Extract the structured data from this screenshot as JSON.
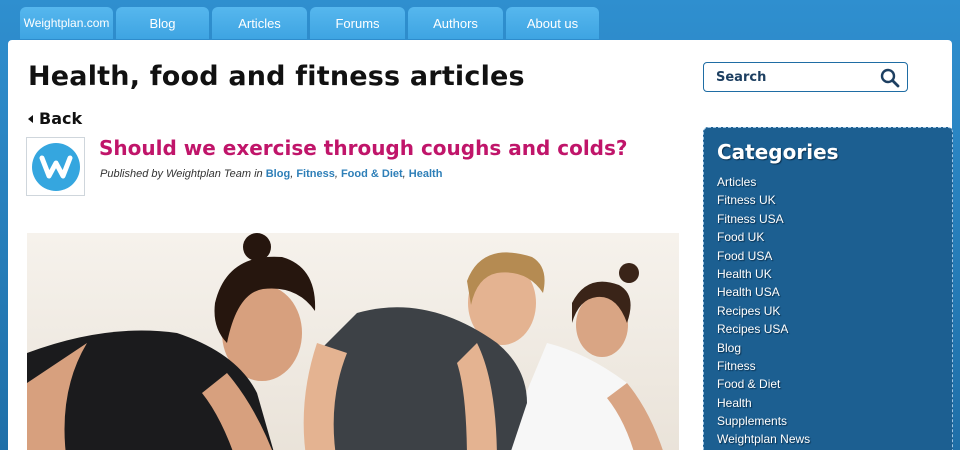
{
  "nav": {
    "brand": "Weightplan.com",
    "tabs": [
      "Blog",
      "Articles",
      "Forums",
      "Authors",
      "About us"
    ]
  },
  "page": {
    "title": "Health, food and fitness articles",
    "back_label": "Back"
  },
  "article": {
    "title": "Should we exercise through coughs and colds?",
    "byline_prefix": "Published by Weightplan Team in",
    "tags": [
      "Blog",
      "Fitness",
      "Food & Diet",
      "Health"
    ]
  },
  "search": {
    "placeholder": "Search"
  },
  "categories": {
    "heading": "Categories",
    "items": [
      "Articles",
      "Fitness UK",
      "Fitness USA",
      "Food UK",
      "Food USA",
      "Health UK",
      "Health USA",
      "Recipes UK",
      "Recipes USA",
      "Blog",
      "Fitness",
      "Food & Diet",
      "Health",
      "Supplements",
      "Weightplan News"
    ]
  },
  "colors": {
    "accent_blue": "#3ea4e2",
    "title_magenta": "#c0156a",
    "sidebar_blue": "#1c5f91"
  },
  "icons": {
    "search": "search-icon",
    "back": "back-triangle-icon",
    "avatar": "weightplan-logo-icon"
  }
}
